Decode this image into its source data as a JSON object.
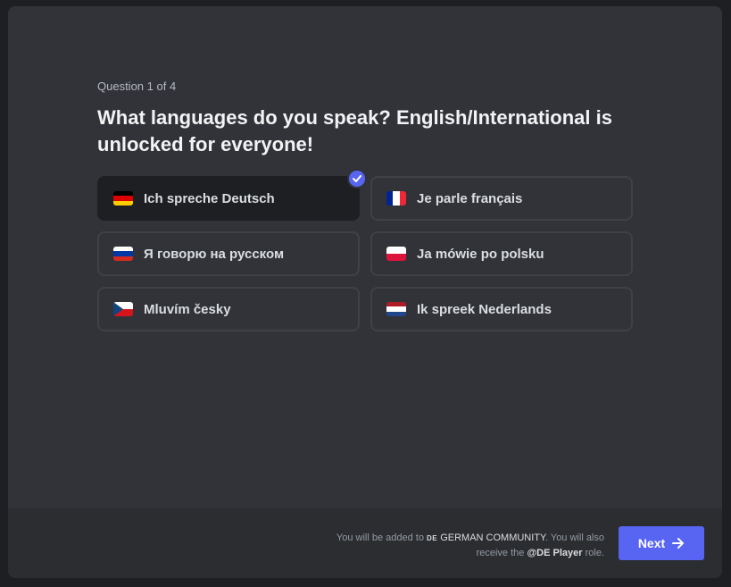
{
  "question": {
    "counter": "Question 1 of 4",
    "title": "What languages do you speak? English/International is unlocked for everyone!"
  },
  "options": [
    {
      "label": "Ich spreche Deutsch",
      "flag": "germany-flag-icon",
      "selected": true
    },
    {
      "label": "Je parle français",
      "flag": "france-flag-icon",
      "selected": false
    },
    {
      "label": "Я говорю на русском",
      "flag": "russia-flag-icon",
      "selected": false
    },
    {
      "label": "Ja mówie po polsku",
      "flag": "poland-flag-icon",
      "selected": false
    },
    {
      "label": "Mluvím česky",
      "flag": "czech-flag-icon",
      "selected": false
    },
    {
      "label": "Ik spreek Nederlands",
      "flag": "netherlands-flag-icon",
      "selected": false
    }
  ],
  "footer": {
    "text_prefix": "You will be added to",
    "server_tag": "DE",
    "server_name": "GERMAN COMMUNITY",
    "text_middle": ". You will also receive the",
    "role_name": "@DE Player",
    "text_suffix": "role."
  },
  "next_button": {
    "label": "Next",
    "icon": "arrow-right-icon"
  },
  "colors": {
    "accent": "#5865f2",
    "background": "#313338",
    "footer": "#2b2d31",
    "selected_option": "#1e1f22"
  }
}
